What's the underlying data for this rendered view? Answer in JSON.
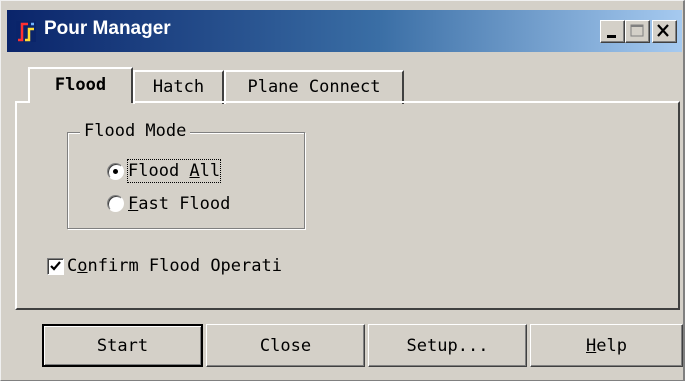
{
  "window": {
    "title": "Pour Manager"
  },
  "title_buttons": {
    "minimize": "minimize",
    "maximize": "maximize",
    "close": "close"
  },
  "tabs": [
    {
      "label": "Flood",
      "selected": true
    },
    {
      "label": "Hatch",
      "selected": false
    },
    {
      "label": "Plane Connect",
      "selected": false
    }
  ],
  "flood_mode": {
    "title": "Flood Mode",
    "options": [
      {
        "prefix": "Flood ",
        "mnemonic": "A",
        "suffix": "ll",
        "checked": true
      },
      {
        "prefix": "",
        "mnemonic": "F",
        "suffix": "ast Flood",
        "checked": false
      }
    ]
  },
  "confirm": {
    "prefix": "C",
    "mnemonic": "o",
    "suffix": "nfirm Flood Operati",
    "checked": true
  },
  "buttons": {
    "start": "Start",
    "close": "Close",
    "setup": "Setup...",
    "help_mnemonic": "H",
    "help_rest": "elp"
  },
  "colors": {
    "face": "#d4d0c8",
    "title_start": "#0a246a",
    "title_end": "#a6caf0",
    "title_text": "#ffffff"
  },
  "icons": {
    "app": "pour-manager-app-icon",
    "minimize": "minimize-icon",
    "maximize": "maximize-icon",
    "close": "close-icon"
  }
}
